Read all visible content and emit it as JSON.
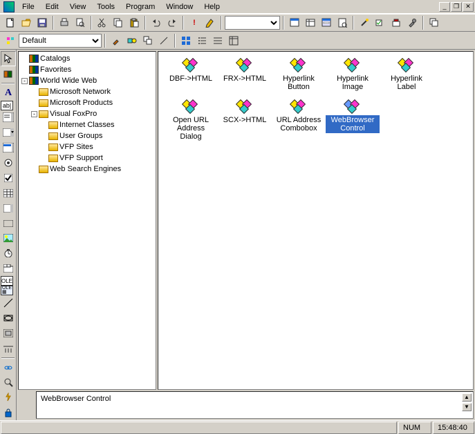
{
  "menu": {
    "items": [
      "File",
      "Edit",
      "View",
      "Tools",
      "Program",
      "Window",
      "Help"
    ]
  },
  "window_controls": {
    "min": "_",
    "restore": "❐",
    "close": "✕"
  },
  "toolbar1": {
    "combo_value": "",
    "buttons": [
      "new",
      "open",
      "save",
      "print",
      "preview",
      "cut",
      "copy",
      "paste",
      "undo",
      "redo",
      "run",
      "modify",
      "form-wizard",
      "database",
      "autoform",
      "autoreport",
      "zoom",
      "build",
      "project",
      "references",
      "options",
      "help"
    ]
  },
  "toolbar2": {
    "selector_value": "Default",
    "buttons": [
      "brush",
      "shapes",
      "two-squares",
      "line",
      "list-view",
      "large-icons",
      "small-icons",
      "details"
    ]
  },
  "left_toolbox": [
    "pointer",
    "book",
    "text-A",
    "edit-ab",
    "textbox",
    "combo",
    "list",
    "radio",
    "check",
    "grid",
    "table1",
    "table2",
    "image",
    "timer",
    "calendar",
    "ole",
    "ole-bound",
    "line",
    "shape",
    "container",
    "separator",
    "hyperlink",
    "zoom",
    "bolt",
    "lock"
  ],
  "tree": {
    "root": [
      {
        "label": "Catalogs",
        "icon": "books"
      },
      {
        "label": "Favorites",
        "icon": "books"
      },
      {
        "label": "World Wide Web",
        "icon": "books",
        "expanded": true,
        "children": [
          {
            "label": "Microsoft Network",
            "icon": "folder"
          },
          {
            "label": "Microsoft Products",
            "icon": "folder"
          },
          {
            "label": "Visual FoxPro",
            "icon": "folder",
            "expanded": true,
            "children": [
              {
                "label": "Internet Classes",
                "icon": "folder"
              },
              {
                "label": "User Groups",
                "icon": "folder"
              },
              {
                "label": "VFP Sites",
                "icon": "folder"
              },
              {
                "label": "VFP Support",
                "icon": "folder"
              }
            ]
          },
          {
            "label": "Web Search Engines",
            "icon": "folder"
          }
        ]
      }
    ]
  },
  "items": [
    {
      "label": "DBF->HTML",
      "selected": false
    },
    {
      "label": "FRX->HTML",
      "selected": false
    },
    {
      "label": "Hyperlink Button",
      "selected": false
    },
    {
      "label": "Hyperlink Image",
      "selected": false
    },
    {
      "label": "Hyperlink Label",
      "selected": false
    },
    {
      "label": "Open URL Address Dialog",
      "selected": false
    },
    {
      "label": "SCX->HTML",
      "selected": false
    },
    {
      "label": "URL Address Combobox",
      "selected": false
    },
    {
      "label": "WebBrowser Control",
      "selected": true,
      "blue_icon": true
    }
  ],
  "status_pane": {
    "text": "WebBrowser Control"
  },
  "statusbar": {
    "indicator": "NUM",
    "time": "15:48:40"
  }
}
